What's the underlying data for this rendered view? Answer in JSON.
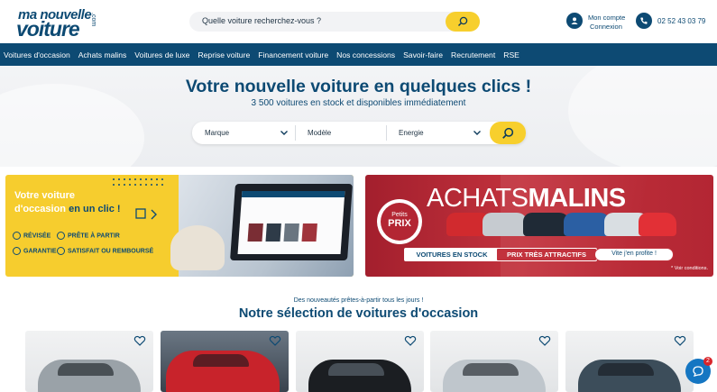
{
  "header": {
    "logo": {
      "line1": "ma nouvelle",
      "line2": "voiture",
      "suffix": ".com"
    },
    "search": {
      "placeholder": "Quelle voiture recherchez-vous ?"
    },
    "account": {
      "line1": "Mon compte",
      "line2": "Connexion"
    },
    "phone": "02 52 43 03 79"
  },
  "nav": {
    "items": [
      "Voitures d'occasion",
      "Achats malins",
      "Voitures de luxe",
      "Reprise voiture",
      "Financement voiture",
      "Nos concessions",
      "Savoir-faire",
      "Recrutement",
      "RSE"
    ]
  },
  "hero": {
    "title": "Votre nouvelle voiture en quelques clics !",
    "subtitle": "3 500 voitures en stock et disponibles immédiatement",
    "filters": {
      "brand": "Marque",
      "model": "Modèle",
      "energy": "Energie"
    }
  },
  "banner_left": {
    "title_line1": "Votre voiture",
    "title_line2a": "d'occasion",
    "title_line2b": "en un clic !",
    "features": [
      "RÉVISÉE",
      "PRÊTE À PARTIR",
      "GARANTIE",
      "SATISFAIT OU REMBOURSÉ"
    ]
  },
  "banner_right": {
    "title_a": "ACHATS",
    "title_b": "MALINS",
    "seal_line1": "Petits",
    "seal_line2": "PRIX",
    "pill1": "VOITURES EN STOCK",
    "pill2": "PRIX TRÈS ATTRACTIFS",
    "pill3": "Vite j'en profite !",
    "note": "* Voir conditions."
  },
  "selection": {
    "eyebrow": "Des nouveautés prêtes-à-partir tous les jours !",
    "title": "Notre sélection de voitures d'occasion",
    "card_colors": [
      "#9aa2a8",
      "#c8232b",
      "#1b1e22",
      "#bfc6cc",
      "#3c4d5a"
    ]
  },
  "chat": {
    "badge": "2"
  },
  "colors": {
    "primary": "#0d4a73",
    "accent": "#f7cf2d",
    "promo": "#c2323d"
  }
}
